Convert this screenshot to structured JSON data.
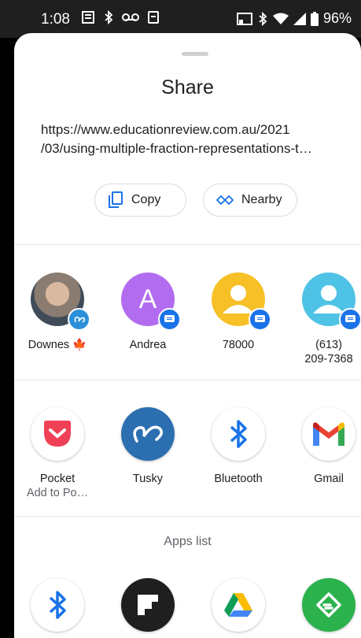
{
  "status_bar": {
    "time": "1:08",
    "battery": "96%"
  },
  "sheet": {
    "title": "Share",
    "url_line1": "https://www.educationreview.com.au/2021",
    "url_line2": "/03/using-multiple-fraction-representations-t…",
    "copy_label": "Copy",
    "nearby_label": "Nearby"
  },
  "direct_targets": [
    {
      "name": "Downes 🍁",
      "sub": "",
      "avatar_color": "#7a6a5a",
      "letter": ""
    },
    {
      "name": "Andrea",
      "sub": "",
      "avatar_color": "#b26cf0",
      "letter": "A"
    },
    {
      "name": "78000",
      "sub": "",
      "avatar_color": "#f6c026",
      "letter": ""
    },
    {
      "name": "(613)",
      "sub": "209-7368",
      "avatar_color": "#4fc3e6",
      "letter": ""
    }
  ],
  "apps": [
    {
      "name": "Pocket",
      "sub": "Add to Po…",
      "icon": "pocket-icon"
    },
    {
      "name": "Tusky",
      "sub": "",
      "icon": "tusky-icon"
    },
    {
      "name": "Bluetooth",
      "sub": "",
      "icon": "bluetooth-icon"
    },
    {
      "name": "Gmail",
      "sub": "",
      "icon": "gmail-icon"
    }
  ],
  "apps_list_label": "Apps list",
  "bottom_row_icons": [
    "bluetooth-icon",
    "flipboard-icon",
    "google-drive-icon",
    "feedly-icon"
  ],
  "colors": {
    "accent": "#1a73e8",
    "pocket": "#ef4056",
    "tusky": "#2b90d9",
    "feedly": "#2bb24c"
  }
}
